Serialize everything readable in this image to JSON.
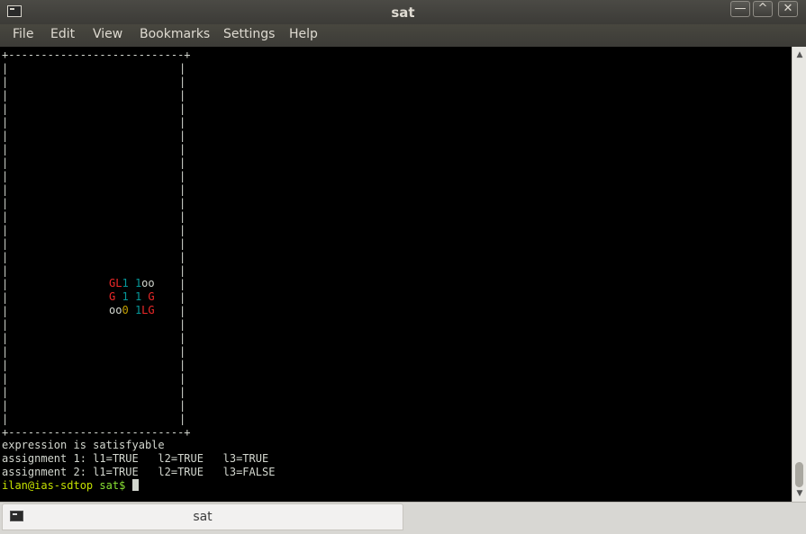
{
  "window": {
    "title": "sat"
  },
  "window_controls": {
    "minimize": "—",
    "maximize": "^",
    "close": "✕"
  },
  "menu": [
    "File",
    "Edit",
    "View",
    "Bookmarks",
    "Settings",
    "Help"
  ],
  "terminal": {
    "box_top": "+---------------------------+",
    "box_side": "|",
    "box_bottom": "+---------------------------+",
    "grid": [
      [
        {
          "t": "G",
          "c": "red"
        },
        {
          "t": "L",
          "c": "red"
        },
        {
          "t": "1",
          "c": "cyan"
        },
        {
          "t": " ",
          "c": ""
        },
        {
          "t": "1",
          "c": "cyan"
        },
        {
          "t": "o",
          "c": ""
        },
        {
          "t": "o",
          "c": ""
        }
      ],
      [
        {
          "t": "G",
          "c": "red"
        },
        {
          "t": " ",
          "c": ""
        },
        {
          "t": "1",
          "c": "cyan"
        },
        {
          "t": " ",
          "c": ""
        },
        {
          "t": "1",
          "c": "cyan"
        },
        {
          "t": " ",
          "c": ""
        },
        {
          "t": "G",
          "c": "red"
        }
      ],
      [
        {
          "t": "o",
          "c": ""
        },
        {
          "t": "o",
          "c": ""
        },
        {
          "t": "0",
          "c": "yellow"
        },
        {
          "t": " ",
          "c": ""
        },
        {
          "t": "1",
          "c": "cyan"
        },
        {
          "t": "L",
          "c": "red"
        },
        {
          "t": "G",
          "c": "red"
        }
      ]
    ],
    "output_lines": [
      "expression is satisfyable",
      "assignment 1: l1=TRUE   l2=TRUE   l3=TRUE",
      "assignment 2: l1=TRUE   l2=TRUE   l3=FALSE"
    ],
    "prompt_user": "ilan@ias-sdtop",
    "prompt_dir": "sat$"
  },
  "taskbar": {
    "tab_label": "sat"
  }
}
